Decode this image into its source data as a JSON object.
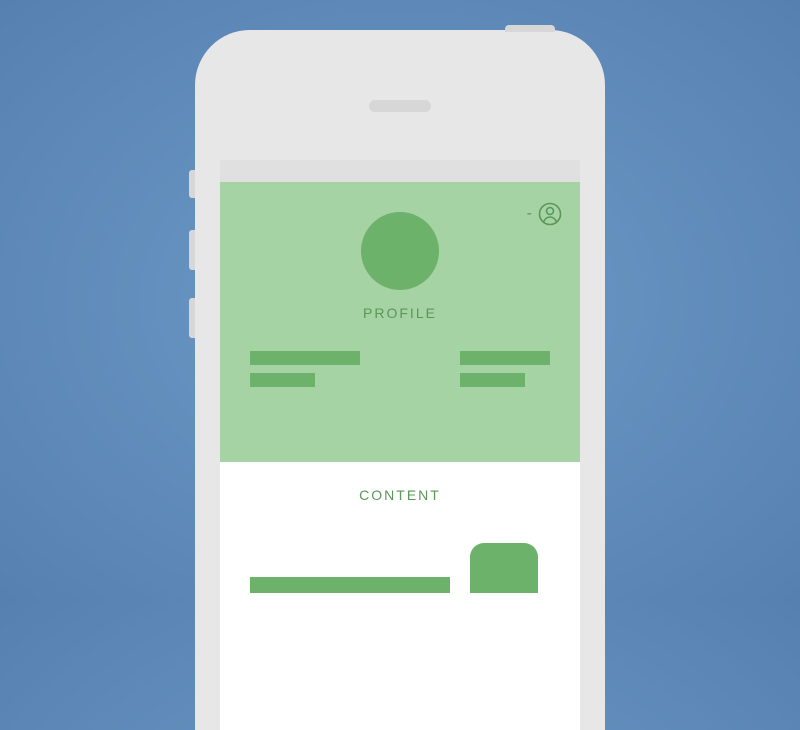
{
  "profile": {
    "label": "PROFILE",
    "dash": "-"
  },
  "content": {
    "label": "CONTENT"
  }
}
